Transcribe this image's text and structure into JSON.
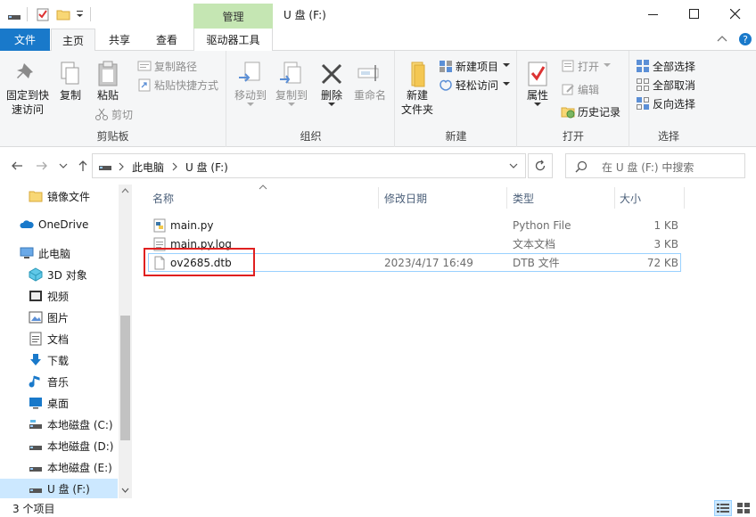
{
  "titlebar": {
    "context_tab": "管理",
    "title": "U 盘 (F:)",
    "minimize": "—",
    "maximize": "☐",
    "close": "✕"
  },
  "tabs": {
    "file": "文件",
    "home": "主页",
    "share": "共享",
    "view": "查看",
    "drive_tools": "驱动器工具"
  },
  "ribbon": {
    "clipboard": {
      "label": "剪贴板",
      "pin_line1": "固定到快",
      "pin_line2": "速访问",
      "copy": "复制",
      "paste": "粘贴",
      "copy_path": "复制路径",
      "paste_shortcut": "粘贴快捷方式",
      "cut": "剪切"
    },
    "organize": {
      "label": "组织",
      "move_to": "移动到",
      "copy_to": "复制到",
      "delete": "删除",
      "rename": "重命名"
    },
    "new": {
      "label": "新建",
      "new_folder_line1": "新建",
      "new_folder_line2": "文件夹",
      "new_item": "新建项目",
      "easy_access": "轻松访问"
    },
    "open": {
      "label": "打开",
      "properties": "属性",
      "open": "打开",
      "edit": "编辑",
      "history": "历史记录"
    },
    "select": {
      "label": "选择",
      "select_all": "全部选择",
      "select_none": "全部取消",
      "invert": "反向选择"
    }
  },
  "address": {
    "crumb1": "此电脑",
    "crumb2": "U 盘 (F:)",
    "search_placeholder": "在 U 盘 (F:) 中搜索"
  },
  "navpane": {
    "items": [
      {
        "label": "镜像文件",
        "icon": "folder-icon"
      },
      {
        "label": "OneDrive",
        "icon": "cloud-icon"
      },
      {
        "label": "此电脑",
        "icon": "computer-icon"
      },
      {
        "label": "3D 对象",
        "icon": "cube-icon"
      },
      {
        "label": "视频",
        "icon": "video-icon"
      },
      {
        "label": "图片",
        "icon": "picture-icon"
      },
      {
        "label": "文档",
        "icon": "document-icon"
      },
      {
        "label": "下载",
        "icon": "download-icon"
      },
      {
        "label": "音乐",
        "icon": "music-icon"
      },
      {
        "label": "桌面",
        "icon": "desktop-icon"
      },
      {
        "label": "本地磁盘 (C:)",
        "icon": "drive-icon"
      },
      {
        "label": "本地磁盘 (D:)",
        "icon": "drive-icon"
      },
      {
        "label": "本地磁盘 (E:)",
        "icon": "drive-icon"
      },
      {
        "label": "U 盘 (F:)",
        "icon": "usb-drive-icon"
      }
    ]
  },
  "columns": {
    "name": "名称",
    "modified": "修改日期",
    "type": "类型",
    "size": "大小"
  },
  "files": [
    {
      "name": "main.py",
      "modified": "",
      "type": "Python File",
      "size": "1 KB"
    },
    {
      "name": "main.py.log",
      "modified": "",
      "type": "文本文档",
      "size": "3 KB"
    },
    {
      "name": "ov2685.dtb",
      "modified": "2023/4/17 16:49",
      "type": "DTB 文件",
      "size": "72 KB"
    }
  ],
  "status": {
    "count": "3 个项目"
  },
  "colors": {
    "file_tab": "#1979ca",
    "context_tab": "#c5e6b3",
    "selection": "#cce8ff",
    "highlight_box": "#e02020"
  }
}
